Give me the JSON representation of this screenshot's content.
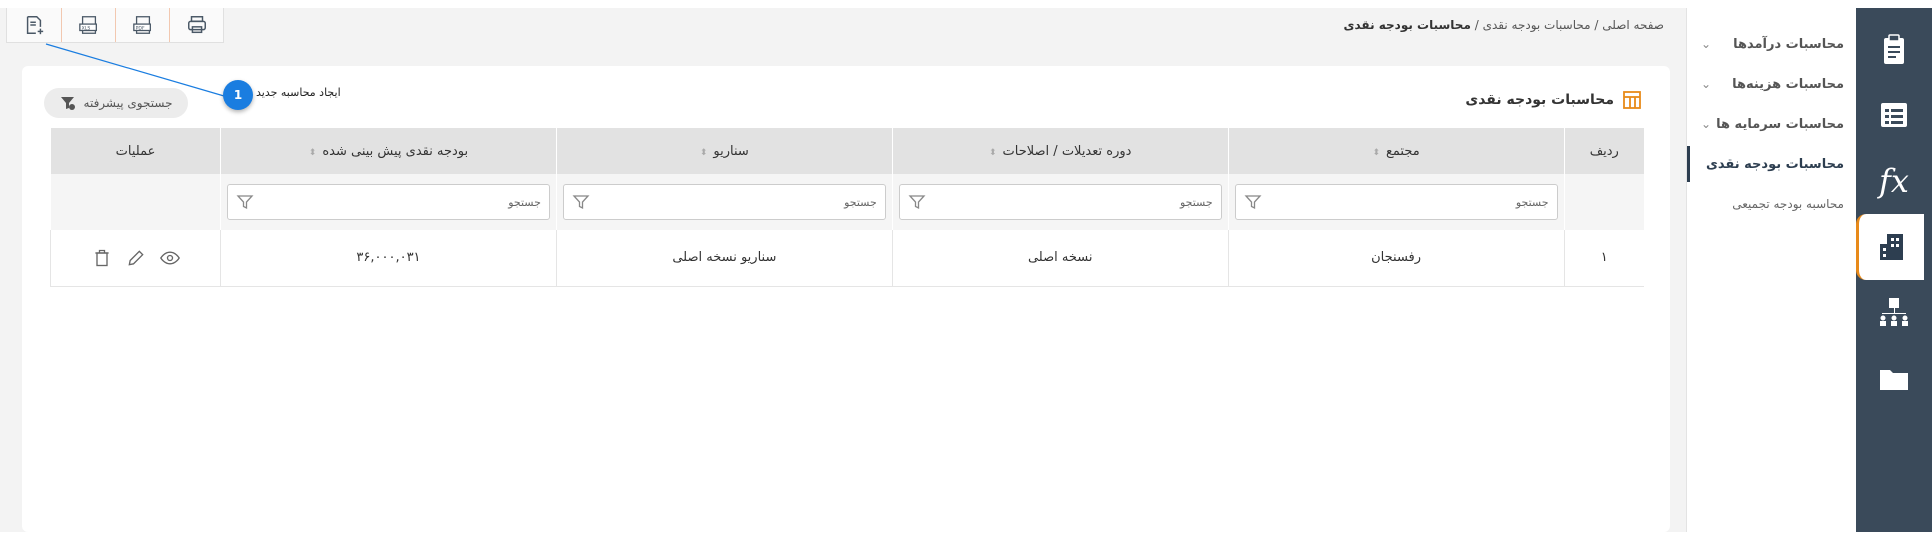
{
  "breadcrumb": {
    "home": "صفحه اصلی",
    "sep1": "/",
    "parent": "محاسبات بودجه نقدی",
    "sep2": "/",
    "current": "محاسبات بودجه نقدی"
  },
  "sidemenu": {
    "items": [
      {
        "label": "محاسبات درآمدها"
      },
      {
        "label": "محاسبات هزینه‌ها"
      },
      {
        "label": "محاسبات سرمایه ها"
      },
      {
        "label": "محاسبات بودجه نقدی"
      },
      {
        "label": "محاسبه بودجه تجمیعی"
      }
    ]
  },
  "card": {
    "title": "محاسبات بودجه نقدی",
    "advanced_search": "جستجوی پیشرفته"
  },
  "table": {
    "headers": [
      "ردیف",
      "مجتمع",
      "دوره تعدیلات / اصلاحات",
      "سناریو",
      "بودجه نقدی پیش بینی شده",
      "عملیات"
    ],
    "filter_placeholder": "جستجو",
    "rows": [
      {
        "index": "۱",
        "complex": "رفسنجان",
        "period": "نسخه اصلی",
        "scenario": "سناریو نسخه اصلی",
        "budget": "۳۶,۰۰۰,۰۳۱"
      }
    ]
  },
  "callout": {
    "number": "1",
    "text": "ایجاد محاسبه جدید"
  },
  "icons": {
    "toolbar": [
      "new-document-icon",
      "xls-export-icon",
      "pdf-export-icon",
      "print-icon"
    ],
    "rail": [
      "clipboard-icon",
      "list-document-icon",
      "fx-icon",
      "building-icon",
      "org-chart-icon",
      "folder-icon"
    ]
  },
  "colors": {
    "rail_bg": "#3a4a5a",
    "accent_orange": "#e88a1a",
    "badge_blue": "#1a7de0"
  }
}
